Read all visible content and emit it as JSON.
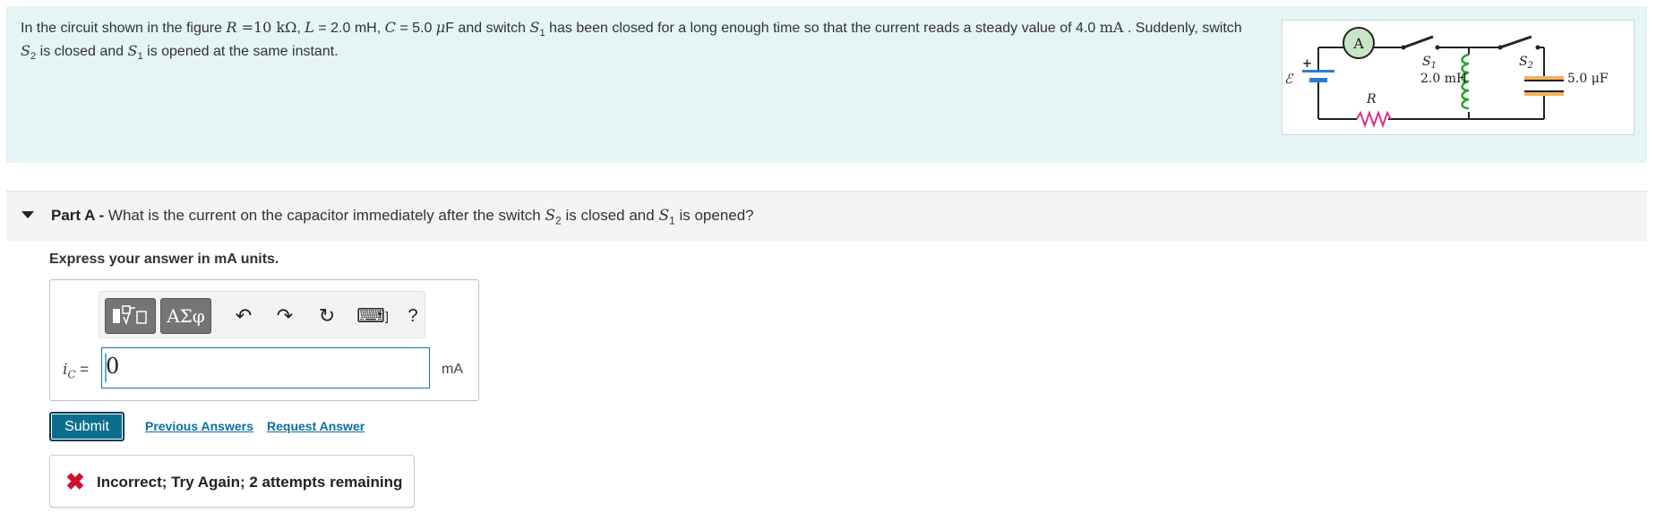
{
  "intro": {
    "t1": "In the circuit shown in the figure ",
    "R_var": "R",
    "R_val": " =10 kΩ",
    "sep1": ",  ",
    "L_var": "L",
    "L_val": " = 2.0 mH,  ",
    "C_var": "C",
    "C_val": " = 5.0 ",
    "mu": "μ",
    "C_unit": "F and switch ",
    "S": "S",
    "s1_sub": "1",
    "t2": " has been closed for a long enough time so that the current reads a steady value of 4.0 ",
    "mA": "mA",
    "t3": " . Suddenly, switch",
    "s2_sub": "2",
    "t4": " is closed and ",
    "t5": " is opened at the same instant."
  },
  "figure": {
    "ammeter": "A",
    "emf": "ℰ",
    "plus": "+",
    "inductor_label": "2.0 mH",
    "resistor_label": "R",
    "capacitor_label": "5.0 μF",
    "s1_sub": "1",
    "s2_sub": "2",
    "s": "S",
    "colors": {
      "inductor": "#2aa32a",
      "resistor": "#e02d8f",
      "capacitor": "#f2b25c",
      "emf": "#2b7fd0"
    }
  },
  "part": {
    "label": "Part A -",
    "question_a": " What is the current on the capacitor immediately after the switch ",
    "question_b": " is closed and ",
    "question_c": " is opened?",
    "s": "S",
    "s2_sub": "2",
    "s1_sub": "1"
  },
  "instruction": "Express your answer in mA units.",
  "toolbar": {
    "template_icon": "template-icon",
    "greek_label": "ΑΣφ",
    "undo_icon": "↶",
    "redo_icon": "↷",
    "reset_icon": "↻",
    "keyboard_icon": "⌨",
    "keyboard_bracket": "]",
    "help_label": "?"
  },
  "answer": {
    "var": "i",
    "var_sub": "C",
    "equals": " =",
    "value": "0",
    "unit": "mA"
  },
  "actions": {
    "submit_label": "Submit",
    "previous_label": "Previous Answers",
    "request_label": "Request Answer"
  },
  "feedback": {
    "icon": "✖",
    "text": "Incorrect; Try Again; 2 attempts remaining",
    "color": "#d0112b"
  },
  "accent": "#0c6e8f"
}
